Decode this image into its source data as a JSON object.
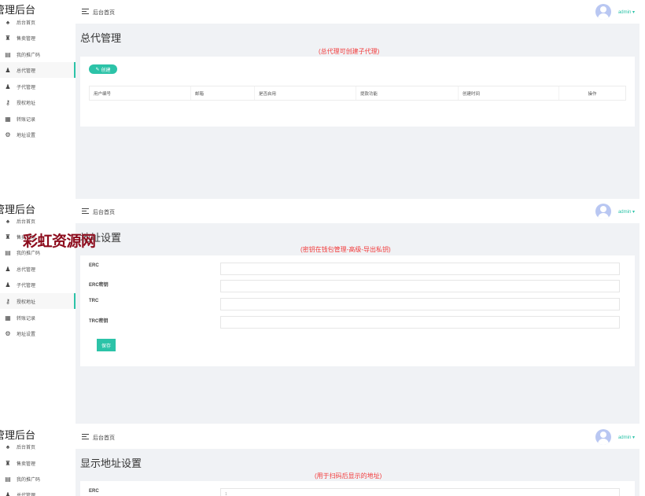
{
  "app": {
    "brand": "管理后台"
  },
  "topbar": {
    "crumb": "后台首页",
    "user": "admin ▾"
  },
  "sidebar": {
    "items": [
      {
        "label": "后台首页",
        "icon": "home-icon",
        "glyph": "♠"
      },
      {
        "label": "售卖管理",
        "icon": "gift-icon",
        "glyph": "♜"
      },
      {
        "label": "我的推广码",
        "icon": "document-icon",
        "glyph": "▤"
      },
      {
        "label": "总代管理",
        "icon": "user-icon",
        "glyph": "♟"
      },
      {
        "label": "子代管理",
        "icon": "users-icon",
        "glyph": "♟"
      },
      {
        "label": "授权地址",
        "icon": "key-icon",
        "glyph": "⚷"
      },
      {
        "label": "转账记录",
        "icon": "record-icon",
        "glyph": "▦"
      },
      {
        "label": "地址设置",
        "icon": "settings-icon",
        "glyph": "⚙"
      }
    ]
  },
  "page1": {
    "title": "总代管理",
    "note": "(总代理可创建子代理)",
    "create_label": "创建",
    "columns": [
      "用户编号",
      "邮箱",
      "是否启用",
      "提款功能",
      "创建时间",
      "操作"
    ]
  },
  "page2": {
    "title": "地址设置",
    "note": "(密钥在钱包管理-高级-导出私钥)",
    "fields": [
      {
        "label": "ERC"
      },
      {
        "label": "ERC密钥"
      },
      {
        "label": "TRC"
      },
      {
        "label": "TRC密钥"
      }
    ],
    "save_label": "保存"
  },
  "page3": {
    "title": "显示地址设置",
    "note": "(用于扫码后显示的地址)",
    "field_label": "ERC",
    "field_value": "1"
  },
  "watermark": "彩虹资源网",
  "colors": {
    "accent": "#2cc3a8",
    "note": "#f23b3b",
    "watermark": "#8c0b1c",
    "background": "#f0f2f5"
  }
}
